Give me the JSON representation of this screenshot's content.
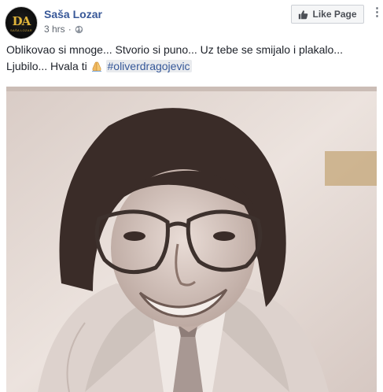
{
  "post": {
    "author": "Saša Lozar",
    "timestamp": "3 hrs",
    "separator": "·",
    "privacy_icon": "globe-icon",
    "like_page_label": "Like Page",
    "menu_icon": "more-options-icon",
    "text_line1": "Oblikovao si mnoge... Stvorio si puno... Uz tebe se smijalo i plakalo...",
    "text_line2": "Ljubilo... Hvala ti",
    "emoji": "folded-hands-emoji",
    "hashtag": "#oliverdragojevic",
    "avatar": {
      "monogram": "DA",
      "subtext": "SAŠA LOZAR"
    },
    "photo": {
      "description_icon": "portrait-photo"
    }
  },
  "colors": {
    "author": "#385898",
    "hashtag_bg": "#e9ebee",
    "hashtag_text": "#365899",
    "meta": "#606770",
    "button_bg": "#f5f6f7"
  }
}
